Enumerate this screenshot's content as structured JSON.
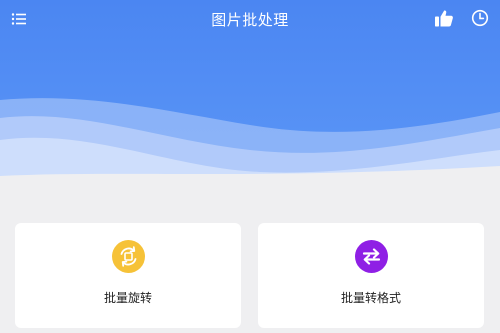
{
  "header": {
    "title": "图片批处理",
    "gradient_top": "#4a86f2",
    "gradient_bottom": "#5a95f6",
    "icons": [
      "menu-icon",
      "thumbs-up-icon",
      "clock-icon"
    ]
  },
  "cards": [
    {
      "label": "批量旋转",
      "icon": "rotate-icon",
      "color": "#f6c238"
    },
    {
      "label": "批量转格式",
      "icon": "swap-arrows-icon",
      "color": "#8f1fe5"
    }
  ],
  "background_color": "#efeff1"
}
